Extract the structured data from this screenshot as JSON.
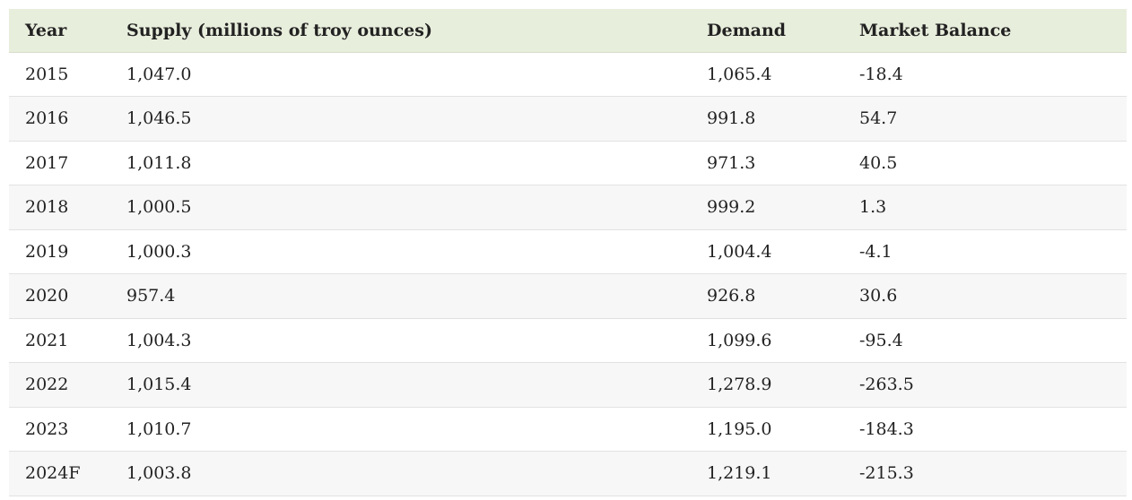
{
  "table": {
    "headers": {
      "year": "Year",
      "supply": "Supply (millions of troy ounces)",
      "demand": "Demand",
      "balance": "Market Balance"
    },
    "rows": [
      {
        "year": "2015",
        "supply": "1,047.0",
        "demand": "1,065.4",
        "balance": "-18.4"
      },
      {
        "year": "2016",
        "supply": "1,046.5",
        "demand": "991.8",
        "balance": "54.7"
      },
      {
        "year": "2017",
        "supply": "1,011.8",
        "demand": "971.3",
        "balance": "40.5"
      },
      {
        "year": "2018",
        "supply": "1,000.5",
        "demand": "999.2",
        "balance": "1.3"
      },
      {
        "year": "2019",
        "supply": "1,000.3",
        "demand": "1,004.4",
        "balance": "-4.1"
      },
      {
        "year": "2020",
        "supply": "957.4",
        "demand": "926.8",
        "balance": "30.6"
      },
      {
        "year": "2021",
        "supply": "1,004.3",
        "demand": "1,099.6",
        "balance": "-95.4"
      },
      {
        "year": "2022",
        "supply": "1,015.4",
        "demand": "1,278.9",
        "balance": "-263.5"
      },
      {
        "year": "2023",
        "supply": "1,010.7",
        "demand": "1,195.0",
        "balance": "-184.3"
      },
      {
        "year": "2024F",
        "supply": "1,003.8",
        "demand": "1,219.1",
        "balance": "-215.3"
      }
    ]
  },
  "colors": {
    "header_background": "#e8eedc",
    "stripe_background": "#f7f7f7",
    "text": "#222222"
  }
}
